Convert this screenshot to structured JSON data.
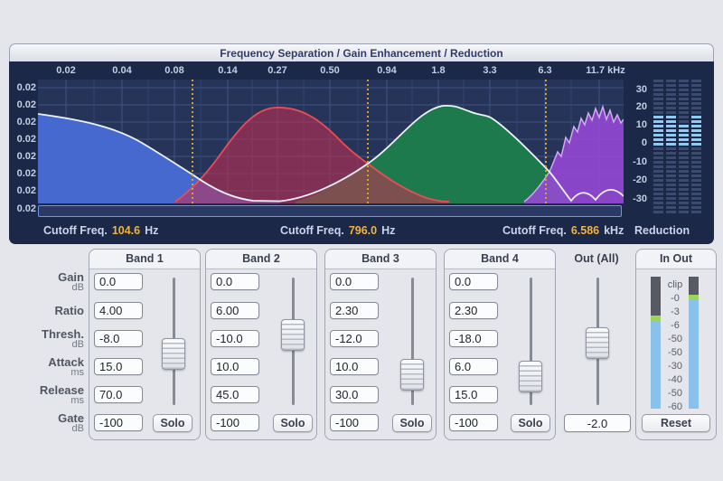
{
  "window": {
    "title": "Frequency Separation / Gain Enhancement / Reduction"
  },
  "graph": {
    "x_ticks": [
      "0.02",
      "0.04",
      "0.08",
      "0.14",
      "0.27",
      "0.50",
      "0.94",
      "1.8",
      "3.3",
      "6.3",
      "11.7 kHz"
    ],
    "y_labels": [
      "0.02",
      "0.02",
      "0.02",
      "0.02",
      "0.02",
      "0.02",
      "0.02",
      "0.02"
    ],
    "cutoffs": [
      {
        "label": "Cutoff Freq.",
        "value": "104.6",
        "unit": "Hz"
      },
      {
        "label": "Cutoff Freq.",
        "value": "796.0",
        "unit": "Hz"
      },
      {
        "label": "Cutoff Freq.",
        "value": "6.586",
        "unit": "kHz"
      }
    ],
    "reduction_label": "Reduction",
    "reduction_scale": [
      "30",
      "20",
      "10",
      "0",
      "-10",
      "-20",
      "-30"
    ],
    "reduction_meter_values_db": [
      16,
      14,
      11,
      16
    ],
    "band_colors": {
      "band1": "#4569cf",
      "band2": "#c82d50",
      "band3": "#1d7a4c",
      "band4": "#9048cc"
    },
    "cutoff_line_color": "#d3a52f"
  },
  "row_labels": [
    {
      "label": "Gain",
      "unit": "dB"
    },
    {
      "label": "Ratio",
      "unit": ""
    },
    {
      "label": "Thresh.",
      "unit": "dB"
    },
    {
      "label": "Attack",
      "unit": "ms"
    },
    {
      "label": "Release",
      "unit": "ms"
    },
    {
      "label": "Gate",
      "unit": "dB"
    }
  ],
  "bands": [
    {
      "name": "Band 1",
      "gain": "0.0",
      "ratio": "4.00",
      "thresh": "-8.0",
      "attack": "15.0",
      "release": "70.0",
      "gate": "-100",
      "solo": "Solo"
    },
    {
      "name": "Band 2",
      "gain": "0.0",
      "ratio": "6.00",
      "thresh": "-10.0",
      "attack": "10.0",
      "release": "45.0",
      "gate": "-100",
      "solo": "Solo"
    },
    {
      "name": "Band 3",
      "gain": "0.0",
      "ratio": "2.30",
      "thresh": "-12.0",
      "attack": "10.0",
      "release": "30.0",
      "gate": "-100",
      "solo": "Solo"
    },
    {
      "name": "Band 4",
      "gain": "0.0",
      "ratio": "2.30",
      "thresh": "-18.0",
      "attack": "6.0",
      "release": "15.0",
      "gate": "-100",
      "solo": "Solo"
    }
  ],
  "out_all": {
    "title": "Out (All)",
    "value": "-2.0"
  },
  "in_out": {
    "title": "In Out",
    "scale": [
      "clip",
      "-0",
      "-3",
      "-6",
      "-50",
      "-50",
      "-30",
      "-40",
      "-50",
      "-60"
    ],
    "reset": "Reset"
  }
}
